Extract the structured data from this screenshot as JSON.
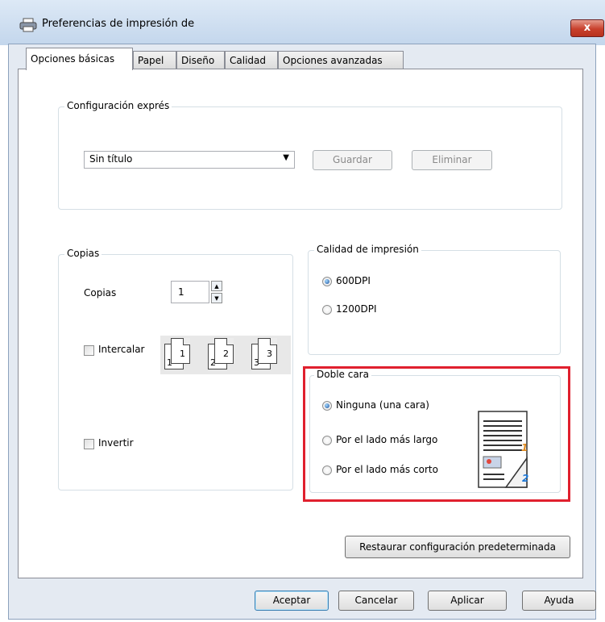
{
  "window": {
    "title": "Preferencias de impresión de",
    "close_label": "x"
  },
  "tabs": [
    {
      "label": "Opciones básicas"
    },
    {
      "label": "Papel"
    },
    {
      "label": "Diseño"
    },
    {
      "label": "Calidad"
    },
    {
      "label": "Opciones avanzadas"
    }
  ],
  "express": {
    "legend": "Configuración exprés",
    "select_value": "Sin título",
    "save_label": "Guardar",
    "delete_label": "Eliminar"
  },
  "copies": {
    "legend": "Copias",
    "label": "Copias",
    "value": "1",
    "collate_label": "Intercalar",
    "collate_pages": [
      "1",
      "1",
      "2",
      "2",
      "3",
      "3"
    ],
    "reverse_label": "Invertir"
  },
  "quality": {
    "legend": "Calidad de impresión",
    "options": [
      "600DPI",
      "1200DPI"
    ],
    "selected": "600DPI"
  },
  "duplex": {
    "legend": "Doble cara",
    "options": [
      "Ninguna (una cara)",
      "Por el lado más largo",
      "Por el lado más corto"
    ],
    "selected": "Ninguna (una cara)",
    "page_numbers": [
      "1",
      "2"
    ]
  },
  "restore_label": "Restaurar configuración predeterminada",
  "footer": {
    "ok": "Aceptar",
    "cancel": "Cancelar",
    "apply": "Aplicar",
    "help": "Ayuda"
  },
  "colors": {
    "highlight": "#e0202e",
    "accent": "#1b4f9c"
  }
}
